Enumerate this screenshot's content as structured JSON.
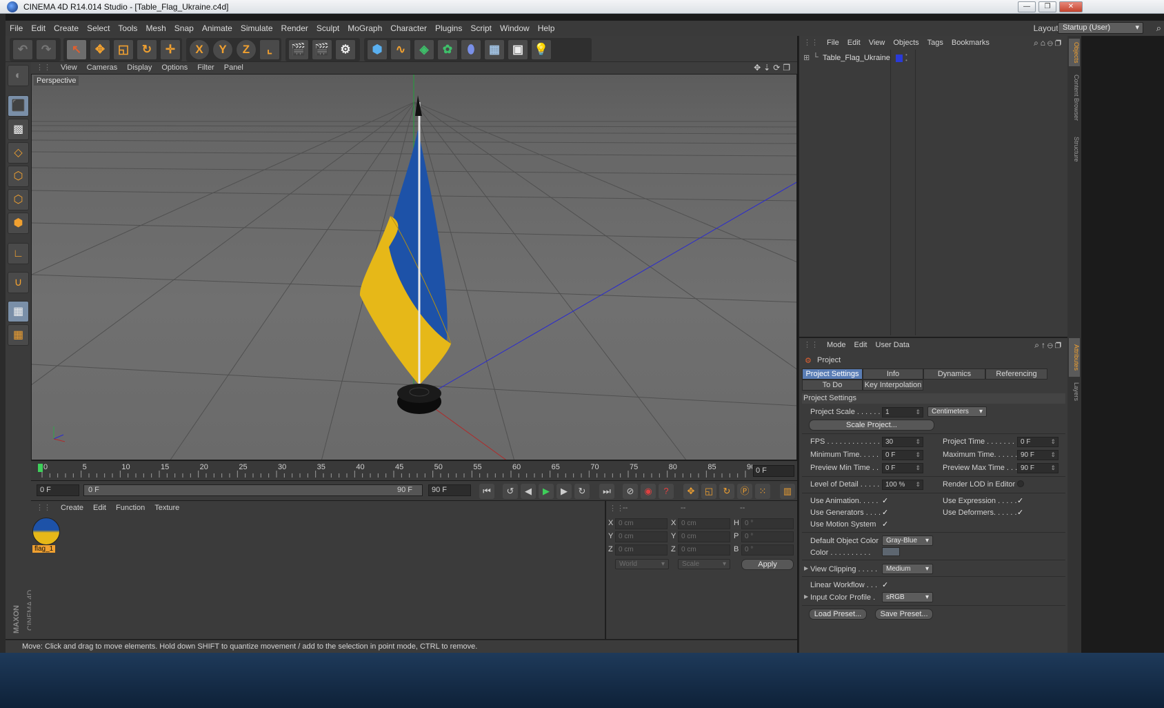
{
  "window": {
    "title": "CINEMA 4D R14.014 Studio - [Table_Flag_Ukraine.c4d]",
    "min": "—",
    "max": "❐",
    "close": "✕"
  },
  "menu": {
    "items": [
      "File",
      "Edit",
      "Create",
      "Select",
      "Tools",
      "Mesh",
      "Snap",
      "Animate",
      "Simulate",
      "Render",
      "Sculpt",
      "MoGraph",
      "Character",
      "Plugins",
      "Script",
      "Window",
      "Help"
    ],
    "layout_label": "Layout:",
    "layout_value": "Startup (User)"
  },
  "toolbar": {
    "x": "X",
    "y": "Y",
    "z": "Z"
  },
  "viewport": {
    "menu": [
      "View",
      "Cameras",
      "Display",
      "Options",
      "Filter",
      "Panel"
    ],
    "label": "Perspective"
  },
  "timeline": {
    "ticks": [
      "0",
      "5",
      "10",
      "15",
      "20",
      "25",
      "30",
      "35",
      "40",
      "45",
      "50",
      "55",
      "60",
      "65",
      "70",
      "75",
      "80",
      "85",
      "90"
    ],
    "current_frame": "0 F"
  },
  "playbar": {
    "start": "0 F",
    "range_start": "0 F",
    "range_end": "90 F",
    "end": "90 F"
  },
  "materials": {
    "menu": [
      "Create",
      "Edit",
      "Function",
      "Texture"
    ],
    "item_name": "flag_1"
  },
  "coords": {
    "headers": [
      "--",
      "--",
      "--"
    ],
    "rows": [
      {
        "a": "X",
        "av": "0 cm",
        "b": "X",
        "bv": "0 cm",
        "c": "H",
        "cv": "0 °"
      },
      {
        "a": "Y",
        "av": "0 cm",
        "b": "Y",
        "bv": "0 cm",
        "c": "P",
        "cv": "0 °"
      },
      {
        "a": "Z",
        "av": "0 cm",
        "b": "Z",
        "bv": "0 cm",
        "c": "B",
        "cv": "0 °"
      }
    ],
    "world": "World",
    "scale": "Scale",
    "apply": "Apply"
  },
  "status": "Move: Click and drag to move elements. Hold down SHIFT to quantize movement / add to the selection in point mode, CTRL to remove.",
  "objects": {
    "menu": [
      "File",
      "Edit",
      "View",
      "Objects",
      "Tags",
      "Bookmarks"
    ],
    "item": "Table_Flag_Ukraine"
  },
  "side_tabs": [
    "Objects",
    "Content Browser",
    "Structure",
    "Attributes",
    "Layers"
  ],
  "attributes": {
    "menu": [
      "Mode",
      "Edit",
      "User Data"
    ],
    "title": "Project",
    "tabs": [
      "Project Settings",
      "Info",
      "Dynamics",
      "Referencing"
    ],
    "tabs2": [
      "To Do",
      "Key Interpolation"
    ],
    "section": "Project Settings",
    "project_scale": {
      "label": "Project Scale . . . . . .",
      "value": "1",
      "unit": "Centimeters"
    },
    "scale_button": "Scale Project...",
    "fps": {
      "label": "FPS . . . . . . . . . . . . . .",
      "value": "30"
    },
    "project_time": {
      "label": "Project Time . . . . . . . .",
      "value": "0 F"
    },
    "min_time": {
      "label": "Minimum Time. . . . .",
      "value": "0 F"
    },
    "max_time": {
      "label": "Maximum Time. . . . . .",
      "value": "90 F"
    },
    "pmin_time": {
      "label": "Preview Min Time . .",
      "value": "0 F"
    },
    "pmax_time": {
      "label": "Preview Max Time . . .",
      "value": "90 F"
    },
    "lod": {
      "label": "Level of Detail . . . . .",
      "value": "100 %"
    },
    "render_lod": "Render LOD in Editor",
    "use_animation": "Use Animation. . . . .",
    "use_expression": "Use Expression . . . . .",
    "use_generators": "Use Generators . . . .",
    "use_deformers": "Use Deformers. . . . . .",
    "use_motion": "Use Motion System",
    "default_color": {
      "label": "Default Object Color",
      "value": "Gray-Blue"
    },
    "color_label": "Color . . . . . . . . . .",
    "view_clipping": {
      "label": "View Clipping . . . . .",
      "value": "Medium"
    },
    "linear_workflow": "Linear Workflow . . .",
    "input_profile": {
      "label": "Input Color Profile .",
      "value": "sRGB"
    },
    "load_preset": "Load Preset...",
    "save_preset": "Save Preset...",
    "check": "✓"
  },
  "logo": {
    "maxon": "MAXON",
    "cinema": "CINEMA 4D"
  }
}
